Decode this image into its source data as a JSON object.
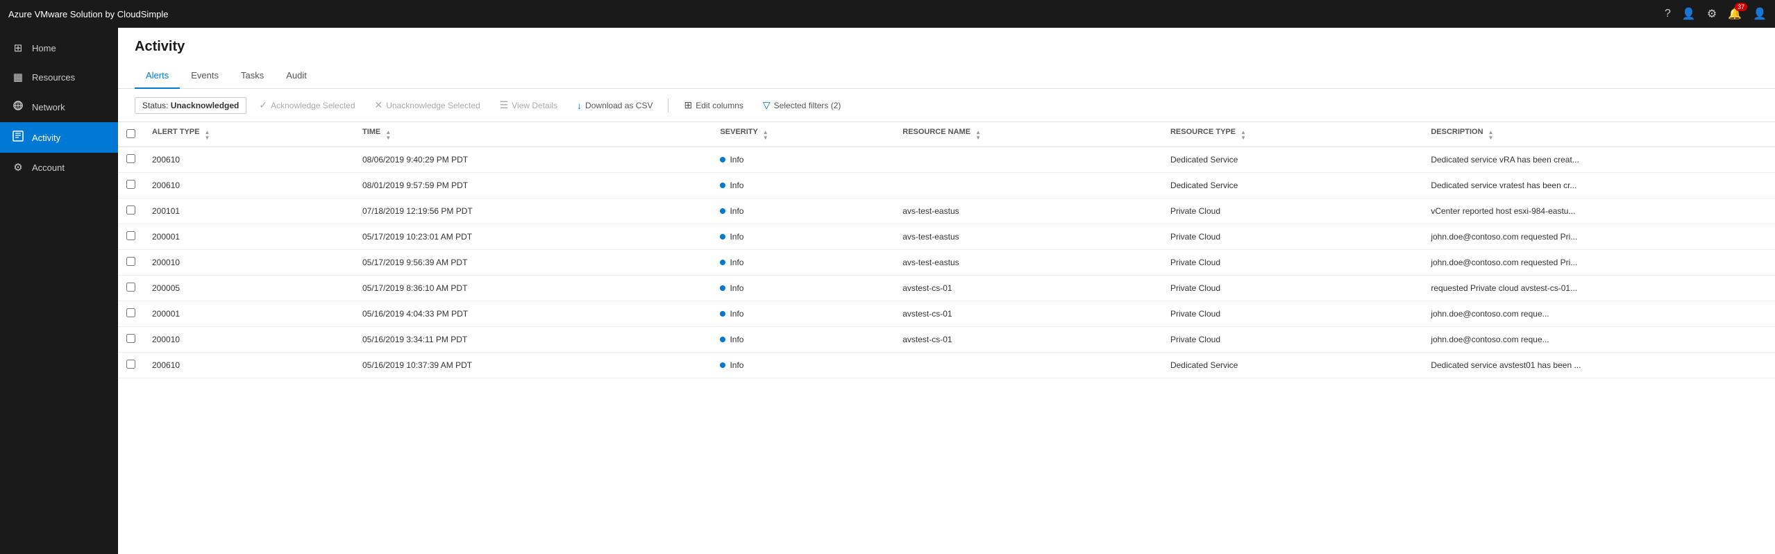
{
  "topbar": {
    "title": "Azure VMware Solution by CloudSimple",
    "notifications_count": "37",
    "icons": [
      "help-icon",
      "person-icon",
      "settings-icon",
      "bell-icon",
      "account-icon"
    ]
  },
  "sidebar": {
    "items": [
      {
        "id": "home",
        "label": "Home",
        "icon": "⊞",
        "active": false
      },
      {
        "id": "resources",
        "label": "Resources",
        "icon": "▦",
        "active": false
      },
      {
        "id": "network",
        "label": "Network",
        "icon": "⧖",
        "active": false
      },
      {
        "id": "activity",
        "label": "Activity",
        "icon": "◫",
        "active": true
      },
      {
        "id": "account",
        "label": "Account",
        "icon": "⚙",
        "active": false
      }
    ]
  },
  "page": {
    "title": "Activity"
  },
  "tabs": [
    {
      "id": "alerts",
      "label": "Alerts",
      "active": true
    },
    {
      "id": "events",
      "label": "Events",
      "active": false
    },
    {
      "id": "tasks",
      "label": "Tasks",
      "active": false
    },
    {
      "id": "audit",
      "label": "Audit",
      "active": false
    }
  ],
  "toolbar": {
    "status_prefix": "Status: ",
    "status_value": "Unacknowledged",
    "buttons": [
      {
        "id": "acknowledge",
        "label": "Acknowledge Selected",
        "icon": "✓",
        "disabled": true
      },
      {
        "id": "unacknowledge",
        "label": "Unacknowledge Selected",
        "icon": "✕",
        "disabled": true
      },
      {
        "id": "view-details",
        "label": "View Details",
        "icon": "☰",
        "disabled": true
      },
      {
        "id": "download",
        "label": "Download as CSV",
        "icon": "↓",
        "disabled": false
      },
      {
        "id": "edit-columns",
        "label": "Edit columns",
        "icon": "⊞",
        "disabled": false
      },
      {
        "id": "selected-filters",
        "label": "Selected filters (2)",
        "icon": "▽",
        "disabled": false
      }
    ]
  },
  "table": {
    "columns": [
      {
        "id": "checkbox",
        "label": ""
      },
      {
        "id": "alert-type",
        "label": "ALERT TYPE"
      },
      {
        "id": "time",
        "label": "TIME"
      },
      {
        "id": "severity",
        "label": "SEVERITY"
      },
      {
        "id": "resource-name",
        "label": "RESOURCE NAME"
      },
      {
        "id": "resource-type",
        "label": "RESOURCE TYPE"
      },
      {
        "id": "description",
        "label": "DESCRIPTION"
      }
    ],
    "rows": [
      {
        "alert_type": "200610",
        "time": "08/06/2019 9:40:29 PM PDT",
        "severity": "Info",
        "resource_name": "",
        "resource_type": "Dedicated Service",
        "description": "Dedicated service vRA has been creat..."
      },
      {
        "alert_type": "200610",
        "time": "08/01/2019 9:57:59 PM PDT",
        "severity": "Info",
        "resource_name": "",
        "resource_type": "Dedicated Service",
        "description": "Dedicated service vratest has been cr..."
      },
      {
        "alert_type": "200101",
        "time": "07/18/2019 12:19:56 PM PDT",
        "severity": "Info",
        "resource_name": "avs-test-eastus",
        "resource_type": "Private Cloud",
        "description": "vCenter reported host esxi-984-eastu..."
      },
      {
        "alert_type": "200001",
        "time": "05/17/2019 10:23:01 AM PDT",
        "severity": "Info",
        "resource_name": "avs-test-eastus",
        "resource_type": "Private Cloud",
        "description": "john.doe@contoso.com requested Pri..."
      },
      {
        "alert_type": "200010",
        "time": "05/17/2019 9:56:39 AM PDT",
        "severity": "Info",
        "resource_name": "avs-test-eastus",
        "resource_type": "Private Cloud",
        "description": "john.doe@contoso.com requested Pri..."
      },
      {
        "alert_type": "200005",
        "time": "05/17/2019 8:36:10 AM PDT",
        "severity": "Info",
        "resource_name": "avstest-cs-01",
        "resource_type": "Private Cloud",
        "description": "requested Private cloud avstest-cs-01..."
      },
      {
        "alert_type": "200001",
        "time": "05/16/2019 4:04:33 PM PDT",
        "severity": "Info",
        "resource_name": "avstest-cs-01",
        "resource_type": "Private Cloud",
        "description": "john.doe@contoso.com  reque..."
      },
      {
        "alert_type": "200010",
        "time": "05/16/2019 3:34:11 PM PDT",
        "severity": "Info",
        "resource_name": "avstest-cs-01",
        "resource_type": "Private Cloud",
        "description": "john.doe@contoso.com  reque..."
      },
      {
        "alert_type": "200610",
        "time": "05/16/2019 10:37:39 AM PDT",
        "severity": "Info",
        "resource_name": "",
        "resource_type": "Dedicated Service",
        "description": "Dedicated service avstest01 has been ..."
      }
    ]
  }
}
